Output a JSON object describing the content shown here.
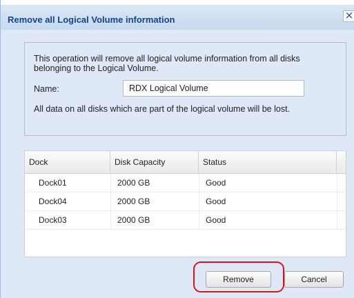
{
  "dialog": {
    "title": "Remove all Logical Volume information",
    "close_glyph": "×"
  },
  "info": {
    "message": "This operation will remove all logical volume information from all disks belonging to the Logical Volume.",
    "name_label": "Name:",
    "name_value": "RDX Logical Volume",
    "warning": "All data on all disks which are part of the logical volume will be lost."
  },
  "grid": {
    "columns": [
      "Dock",
      "Disk Capacity",
      "Status"
    ],
    "rows": [
      {
        "dock": "Dock01",
        "capacity": "2000 GB",
        "status": "Good"
      },
      {
        "dock": "Dock04",
        "capacity": "2000 GB",
        "status": "Good"
      },
      {
        "dock": "Dock03",
        "capacity": "2000 GB",
        "status": "Good"
      }
    ]
  },
  "buttons": {
    "remove": "Remove",
    "cancel": "Cancel"
  },
  "colors": {
    "title_text": "#15428b",
    "panel_bg": "#dfe8f6",
    "highlight": "#d8141a"
  }
}
